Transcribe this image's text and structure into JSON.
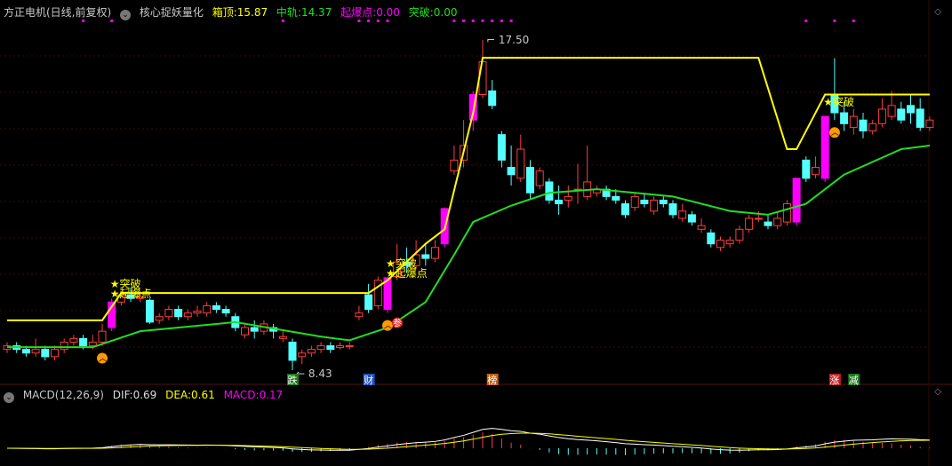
{
  "header": {
    "title": "方正电机(日线,前复权)",
    "indicator": "核心捉妖量化",
    "box_top_label": "箱顶:",
    "box_top": "15.87",
    "mid_label": "中轨:",
    "mid": "14.37",
    "ignite_label": "起爆点:",
    "ignite": "0.00",
    "break_label": "突破:",
    "break": "0.00"
  },
  "macd": {
    "title": "MACD(12,26,9)",
    "dif_label": "DIF:",
    "dif": "0.69",
    "dea_label": "DEA:",
    "dea": "0.61",
    "macd_label": "MACD:",
    "macd": "0.17"
  },
  "colors": {
    "up": "#ff3c3c",
    "down": "#54ffff",
    "ignite": "#ff00ff",
    "box": "#ffff00",
    "mid": "#22dd22"
  },
  "chart_data": {
    "type": "candlestick",
    "high_label": "17.50",
    "low_label": "8.43",
    "candles": [
      [
        9.0,
        9.1,
        9.2,
        8.9
      ],
      [
        9.1,
        9.0,
        9.2,
        8.9
      ],
      [
        9.0,
        8.9,
        9.1,
        8.8
      ],
      [
        8.9,
        9.0,
        9.3,
        8.8
      ],
      [
        9.0,
        8.8,
        9.1,
        8.7
      ],
      [
        8.8,
        9.0,
        9.1,
        8.7
      ],
      [
        9.0,
        9.2,
        9.3,
        8.9
      ],
      [
        9.2,
        9.3,
        9.4,
        9.1
      ],
      [
        9.3,
        9.1,
        9.4,
        9.0
      ],
      [
        9.1,
        9.2,
        9.4,
        9.0
      ],
      [
        9.2,
        9.5,
        9.7,
        9.1
      ],
      [
        9.6,
        10.3,
        10.4,
        9.5
      ],
      [
        10.3,
        10.5,
        10.6,
        10.2
      ],
      [
        10.5,
        10.4,
        10.7,
        10.3
      ],
      [
        10.4,
        10.45,
        10.6,
        10.3
      ],
      [
        10.35,
        9.75,
        10.4,
        9.7
      ],
      [
        9.8,
        9.9,
        10.0,
        9.7
      ],
      [
        9.9,
        10.1,
        10.2,
        9.8
      ],
      [
        10.1,
        9.9,
        10.2,
        9.8
      ],
      [
        9.9,
        10.0,
        10.1,
        9.8
      ],
      [
        10.0,
        10.05,
        10.2,
        9.9
      ],
      [
        10.0,
        10.2,
        10.3,
        9.9
      ],
      [
        10.2,
        10.1,
        10.3,
        10.0
      ],
      [
        10.1,
        10.0,
        10.2,
        9.9
      ],
      [
        9.9,
        9.6,
        10.0,
        9.5
      ],
      [
        9.4,
        9.6,
        9.7,
        9.3
      ],
      [
        9.6,
        9.5,
        9.8,
        9.3
      ],
      [
        9.5,
        9.7,
        9.8,
        9.4
      ],
      [
        9.6,
        9.5,
        9.7,
        9.3
      ],
      [
        9.3,
        9.35,
        9.5,
        9.2
      ],
      [
        9.2,
        8.7,
        9.3,
        8.43
      ],
      [
        8.8,
        8.9,
        9.0,
        8.6
      ],
      [
        8.9,
        9.0,
        9.1,
        8.8
      ],
      [
        9.0,
        9.1,
        9.2,
        8.9
      ],
      [
        9.1,
        9.0,
        9.2,
        8.9
      ],
      [
        9.05,
        9.1,
        9.2,
        9.0
      ],
      [
        9.1,
        9.1,
        9.2,
        9.0
      ],
      [
        9.9,
        10.0,
        10.2,
        9.8
      ],
      [
        10.5,
        10.1,
        10.8,
        10.0
      ],
      [
        10.2,
        10.9,
        11.0,
        10.1
      ],
      [
        10.1,
        10.97,
        10.97,
        10.0
      ],
      [
        11.0,
        11.4,
        11.9,
        10.9
      ],
      [
        11.4,
        11.3,
        11.8,
        11.1
      ],
      [
        11.3,
        11.6,
        12.0,
        11.2
      ],
      [
        11.6,
        11.5,
        11.9,
        11.3
      ],
      [
        11.5,
        11.8,
        12.0,
        11.4
      ],
      [
        11.9,
        12.87,
        12.9,
        11.8
      ],
      [
        13.9,
        14.2,
        14.6,
        13.8
      ],
      [
        14.2,
        14.6,
        15.3,
        14.0
      ],
      [
        15.3,
        16.0,
        16.1,
        15.0
      ],
      [
        16.0,
        16.9,
        17.5,
        15.9
      ],
      [
        16.1,
        15.7,
        16.4,
        15.6
      ],
      [
        14.9,
        14.2,
        15.0,
        14.0
      ],
      [
        14.0,
        13.8,
        14.6,
        13.5
      ],
      [
        13.7,
        14.5,
        14.9,
        13.6
      ],
      [
        14.0,
        13.3,
        14.2,
        13.1
      ],
      [
        13.5,
        13.9,
        14.0,
        13.4
      ],
      [
        13.6,
        13.1,
        13.7,
        13.0
      ],
      [
        13.1,
        13.0,
        13.5,
        12.7
      ],
      [
        13.1,
        13.2,
        13.5,
        12.9
      ],
      [
        13.4,
        13.4,
        14.1,
        13.0
      ],
      [
        13.2,
        13.6,
        14.6,
        13.1
      ],
      [
        13.3,
        13.4,
        13.5,
        13.2
      ],
      [
        13.4,
        13.2,
        13.5,
        13.1
      ],
      [
        13.2,
        13.1,
        13.4,
        13.0
      ],
      [
        13.0,
        12.7,
        13.1,
        12.6
      ],
      [
        12.9,
        13.2,
        13.3,
        12.8
      ],
      [
        13.1,
        13.0,
        13.3,
        12.9
      ],
      [
        12.8,
        13.1,
        13.2,
        12.7
      ],
      [
        13.1,
        13.0,
        13.2,
        12.9
      ],
      [
        13.0,
        12.7,
        13.1,
        12.6
      ],
      [
        12.6,
        12.8,
        13.0,
        12.5
      ],
      [
        12.7,
        12.5,
        12.8,
        12.4
      ],
      [
        12.3,
        12.4,
        12.6,
        12.2
      ],
      [
        12.2,
        11.9,
        12.3,
        11.8
      ],
      [
        11.8,
        12.0,
        12.1,
        11.7
      ],
      [
        11.9,
        12.0,
        12.1,
        11.8
      ],
      [
        12.0,
        12.3,
        12.4,
        11.9
      ],
      [
        12.3,
        12.6,
        12.7,
        12.2
      ],
      [
        12.6,
        12.6,
        12.8,
        12.5
      ],
      [
        12.5,
        12.4,
        12.7,
        12.3
      ],
      [
        12.4,
        12.6,
        12.8,
        12.3
      ],
      [
        12.5,
        13.0,
        13.1,
        12.4
      ],
      [
        12.5,
        13.7,
        13.7,
        12.4
      ],
      [
        14.2,
        13.7,
        14.3,
        13.6
      ],
      [
        13.8,
        14.0,
        14.3,
        13.7
      ],
      [
        13.7,
        15.4,
        15.4,
        13.6
      ],
      [
        16.0,
        15.5,
        17.0,
        15.3
      ],
      [
        15.5,
        15.2,
        15.8,
        15.0
      ],
      [
        15.1,
        15.4,
        15.6,
        14.9
      ],
      [
        15.3,
        15.0,
        15.5,
        14.8
      ],
      [
        15.0,
        15.2,
        15.3,
        14.9
      ],
      [
        15.2,
        15.6,
        15.9,
        15.1
      ],
      [
        15.4,
        15.7,
        16.1,
        15.3
      ],
      [
        15.6,
        15.3,
        15.8,
        15.2
      ],
      [
        15.7,
        15.5,
        16.0,
        15.2
      ],
      [
        15.6,
        15.1,
        15.9,
        15.0
      ],
      [
        15.1,
        15.3,
        15.4,
        15.0
      ]
    ],
    "ignite_candles": [
      11,
      40,
      46,
      49,
      83,
      86
    ],
    "box_top_line": [
      [
        0,
        9.8
      ],
      [
        10,
        9.8
      ],
      [
        12,
        10.55
      ],
      [
        38,
        10.55
      ],
      [
        40,
        10.9
      ],
      [
        44,
        11.9
      ],
      [
        46,
        12.3
      ],
      [
        49,
        15.5
      ],
      [
        50,
        17.01
      ],
      [
        79,
        17.01
      ],
      [
        82,
        14.5
      ],
      [
        83,
        14.5
      ],
      [
        86,
        16.0
      ],
      [
        97,
        16.0
      ]
    ],
    "mid_line": [
      [
        0,
        9.06
      ],
      [
        9,
        9.06
      ],
      [
        14,
        9.5
      ],
      [
        24,
        9.75
      ],
      [
        33,
        9.35
      ],
      [
        36,
        9.25
      ],
      [
        40,
        9.6
      ],
      [
        44,
        10.3
      ],
      [
        47,
        11.6
      ],
      [
        49,
        12.5
      ],
      [
        53,
        12.95
      ],
      [
        57,
        13.3
      ],
      [
        62,
        13.4
      ],
      [
        70,
        13.2
      ],
      [
        76,
        12.8
      ],
      [
        80,
        12.7
      ],
      [
        84,
        13.0
      ],
      [
        88,
        13.8
      ],
      [
        94,
        14.5
      ],
      [
        97,
        14.6
      ]
    ],
    "signals": [
      {
        "i": 11,
        "lines": [
          "★突破",
          "★起爆点"
        ]
      },
      {
        "i": 40,
        "lines": [
          "★突破",
          "★起爆点"
        ]
      },
      {
        "i": 86,
        "lines": [
          "★突破"
        ]
      }
    ],
    "markers": [
      {
        "i": 10,
        "text": ""
      },
      {
        "i": 40,
        "text": "参"
      },
      {
        "i": 87,
        "text": ""
      }
    ],
    "events": [
      {
        "i": 30,
        "text": "跌",
        "color": "#1a7a1a"
      },
      {
        "i": 38,
        "text": "财",
        "color": "#2050c0"
      },
      {
        "i": 51,
        "text": "榜",
        "color": "#c06010"
      },
      {
        "i": 87,
        "text": "涨",
        "color": "#c02020"
      },
      {
        "i": 89,
        "text": "减",
        "color": "#1a7a1a"
      }
    ],
    "dots": [
      8,
      11,
      29,
      37,
      38,
      39,
      40,
      47,
      48,
      49,
      50,
      51,
      52,
      53,
      84,
      87,
      89
    ]
  }
}
